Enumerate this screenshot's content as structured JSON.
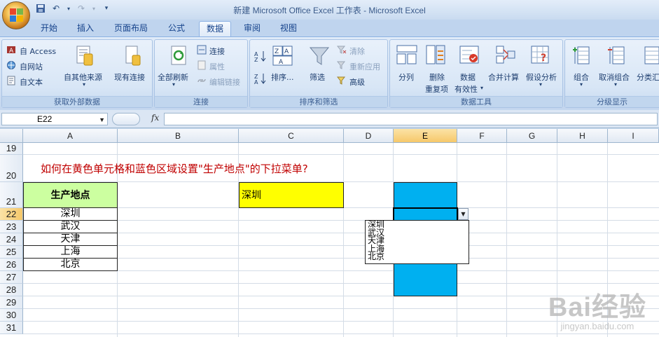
{
  "window_title": "新建 Microsoft Office Excel 工作表 - Microsoft Excel",
  "tabs": [
    {
      "label": "开始"
    },
    {
      "label": "插入"
    },
    {
      "label": "页面布局"
    },
    {
      "label": "公式"
    },
    {
      "label": "数据",
      "active": true
    },
    {
      "label": "审阅"
    },
    {
      "label": "视图"
    }
  ],
  "ribbon": {
    "get_external_data": {
      "label": "获取外部数据",
      "from_access": "自 Access",
      "from_web": "自网站",
      "from_text": "自文本",
      "other_sources": "自其他来源",
      "existing_connections": "现有连接"
    },
    "connections": {
      "label": "连接",
      "refresh_all": "全部刷新",
      "connections": "连接",
      "properties": "属性",
      "edit_links": "编辑链接"
    },
    "sort_filter": {
      "label": "排序和筛选",
      "sort": "排序...",
      "filter": "筛选",
      "clear": "清除",
      "reapply": "重新应用",
      "advanced": "高级"
    },
    "data_tools": {
      "label": "数据工具",
      "text_to_columns": "分列",
      "remove_duplicates_1": "删除",
      "remove_duplicates_2": "重复项",
      "data_validation_1": "数据",
      "data_validation_2": "有效性",
      "consolidate": "合并计算",
      "what_if": "假设分析"
    },
    "outline": {
      "label": "分级显示",
      "group": "组合",
      "ungroup": "取消组合",
      "subtotal": "分类汇"
    }
  },
  "formula_bar": {
    "name_box": "E22",
    "fx": "fx",
    "formula": ""
  },
  "columns": [
    "A",
    "B",
    "C",
    "D",
    "E",
    "F",
    "G",
    "H",
    "I"
  ],
  "rows": [
    "19",
    "20",
    "21",
    "22",
    "23",
    "24",
    "25",
    "26",
    "27",
    "28",
    "29",
    "30",
    "31"
  ],
  "sheet": {
    "question": "如何在黄色单元格和蓝色区域设置\"生产地点\"的下拉菜单?",
    "header": "生产地点",
    "places": [
      "深圳",
      "武汉",
      "天津",
      "上海",
      "北京"
    ],
    "yellow_value": "深圳"
  },
  "dropdown": {
    "items": [
      "深圳",
      "武汉",
      "天津",
      "上海",
      "北京"
    ]
  },
  "watermark": {
    "main": "Bai经验",
    "sub": "jingyan.baidu.com"
  },
  "colors": {
    "header_green": "#ccffa0",
    "yellow": "#ffff00",
    "blue": "#00b0f0",
    "question_red": "#c00000"
  }
}
